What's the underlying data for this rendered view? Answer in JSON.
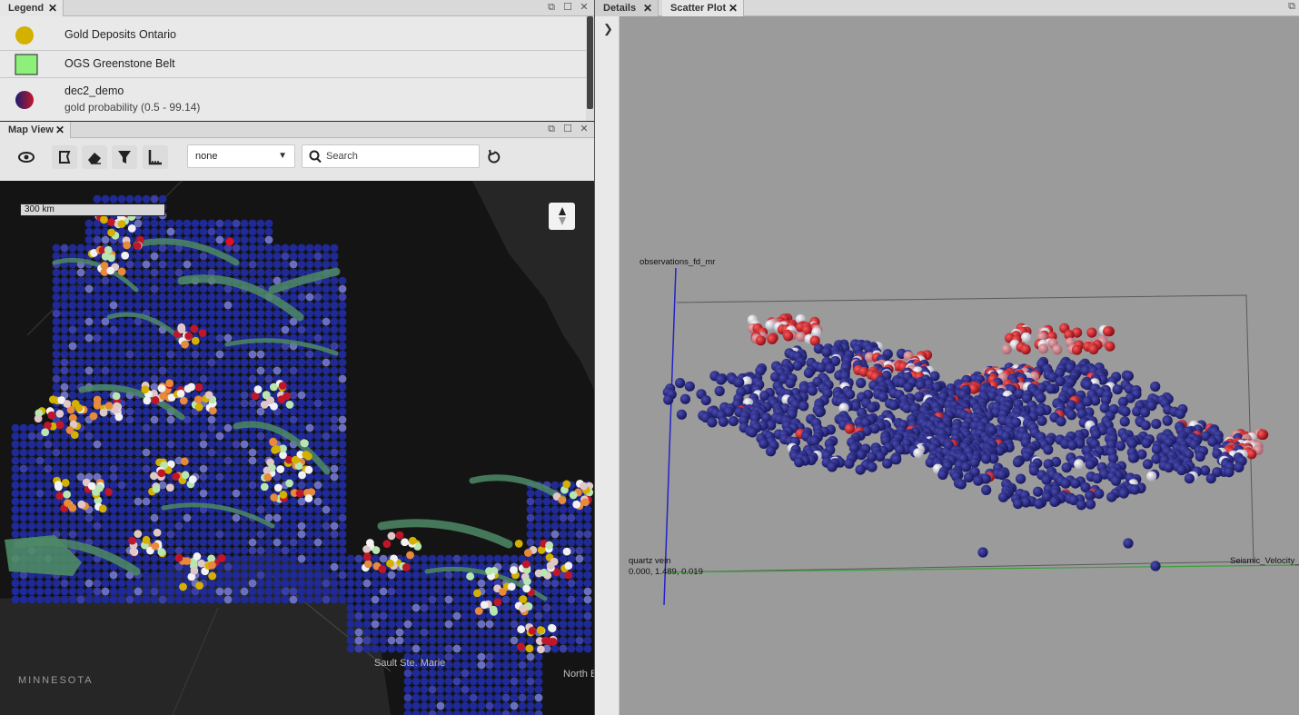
{
  "legend_panel": {
    "tab_label": "Legend",
    "items": [
      {
        "name": "Gold Deposits Ontario",
        "subtitle": "",
        "symbol": "circle",
        "color": "#d4b000"
      },
      {
        "name": "OGS Greenstone Belt",
        "subtitle": "",
        "symbol": "square",
        "color": "#8cf07a"
      },
      {
        "name": "dec2_demo",
        "subtitle": "gold probability (0.5 - 99.14)",
        "symbol": "gradient-circle",
        "color": "#c0162a"
      }
    ]
  },
  "map_panel": {
    "tab_label": "Map View",
    "toolbar": {
      "icons": [
        "eye-icon",
        "select-area-icon",
        "eraser-icon",
        "filter-icon",
        "measure-icon",
        "refresh-icon"
      ],
      "select_value": "none",
      "search_placeholder": "Search"
    },
    "map": {
      "scale_label": "300 km",
      "place_labels": [
        "MINNESOTA",
        "Sault Ste. Marie",
        "North Bay"
      ],
      "compass_icon": "north-arrow-icon",
      "colors": {
        "water": "#262626",
        "land": "#141414",
        "grid": "#1f2f8c",
        "greenstone": "#4d8a66",
        "deposit": "#d4b000",
        "high_prob": "#c0162a"
      }
    }
  },
  "details_panel": {
    "tabs": [
      "Details",
      "Scatter Plot"
    ],
    "active_tab": "Scatter Plot",
    "collapse_icon": "chevron-right-icon",
    "scatter": {
      "axis_z_label": "observations_fd_mr",
      "axis_x_label": "quartz vein",
      "axis_y_label": "Seismic_Velocity_",
      "origin_readout": "0.000, 1.489, 0.019",
      "colors": {
        "low": "#1c1d6e",
        "high": "#b8141e",
        "mid": "#d7d7e0"
      }
    }
  }
}
